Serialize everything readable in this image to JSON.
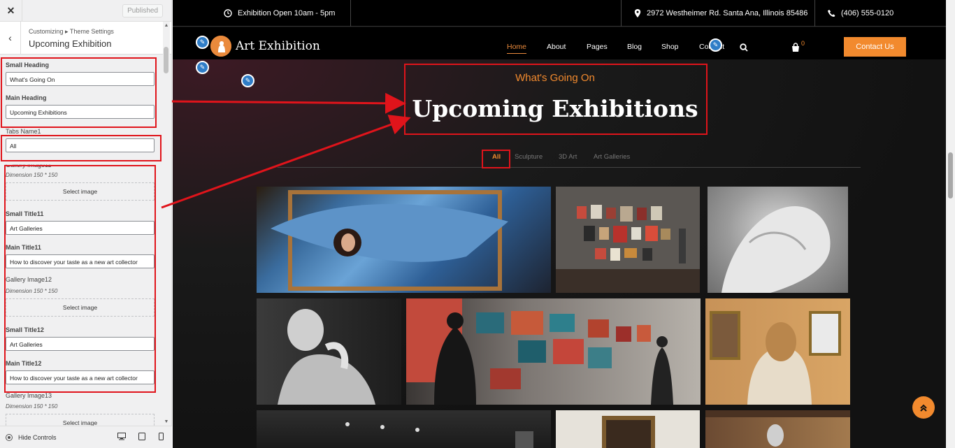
{
  "customizer": {
    "close_icon": "close-icon",
    "published_label": "Published",
    "breadcrumb": "Customizing ▸ Theme Settings",
    "section_title": "Upcoming Exhibition",
    "fields": {
      "small_heading_label": "Small Heading",
      "small_heading_value": "What's Going On",
      "main_heading_label": "Main Heading",
      "main_heading_value": "Upcoming Exhibitions",
      "tabs_name_label": "Tabs Name1",
      "tabs_name_value": "All",
      "gallery_image11_label": "Gallery Image11",
      "dimension_hint": "Dimension 150 * 150",
      "select_image_label": "Select image",
      "small_title11_label": "Small Title11",
      "small_title11_value": "Art Galleries",
      "main_title11_label": "Main Title11",
      "main_title11_value": "How to discover your taste as a new art collector",
      "gallery_image12_label": "Gallery Image12",
      "small_title12_label": "Small Title12",
      "small_title12_value": "Art Galleries",
      "main_title12_label": "Main Title12",
      "main_title12_value": "How to discover your taste as a new art collector",
      "gallery_image13_label": "Gallery Image13"
    },
    "footer": {
      "hide_controls_label": "Hide Controls",
      "devices": [
        "desktop-icon",
        "tablet-icon",
        "mobile-icon"
      ]
    }
  },
  "site": {
    "topbar": {
      "hours": "Exhibition Open 10am - 5pm",
      "address": "2972 Westheimer Rd. Santa Ana, Illinois 85486",
      "phone": "(406) 555-0120"
    },
    "logo_text": "Art Exhibition",
    "nav": [
      "Home",
      "About",
      "Pages",
      "Blog",
      "Shop",
      "Contact"
    ],
    "cart_count": "0",
    "contact_button": "Contact Us",
    "section": {
      "sub_heading": "What's Going On",
      "main_heading": "Upcoming Exhibitions",
      "tabs": [
        "All",
        "Sculpture",
        "3D Art",
        "Art Galleries"
      ],
      "active_tab": "All"
    },
    "colors": {
      "accent": "#f28a2e",
      "highlight": "#e0141b",
      "edit_dot": "#2f7dc7"
    }
  }
}
